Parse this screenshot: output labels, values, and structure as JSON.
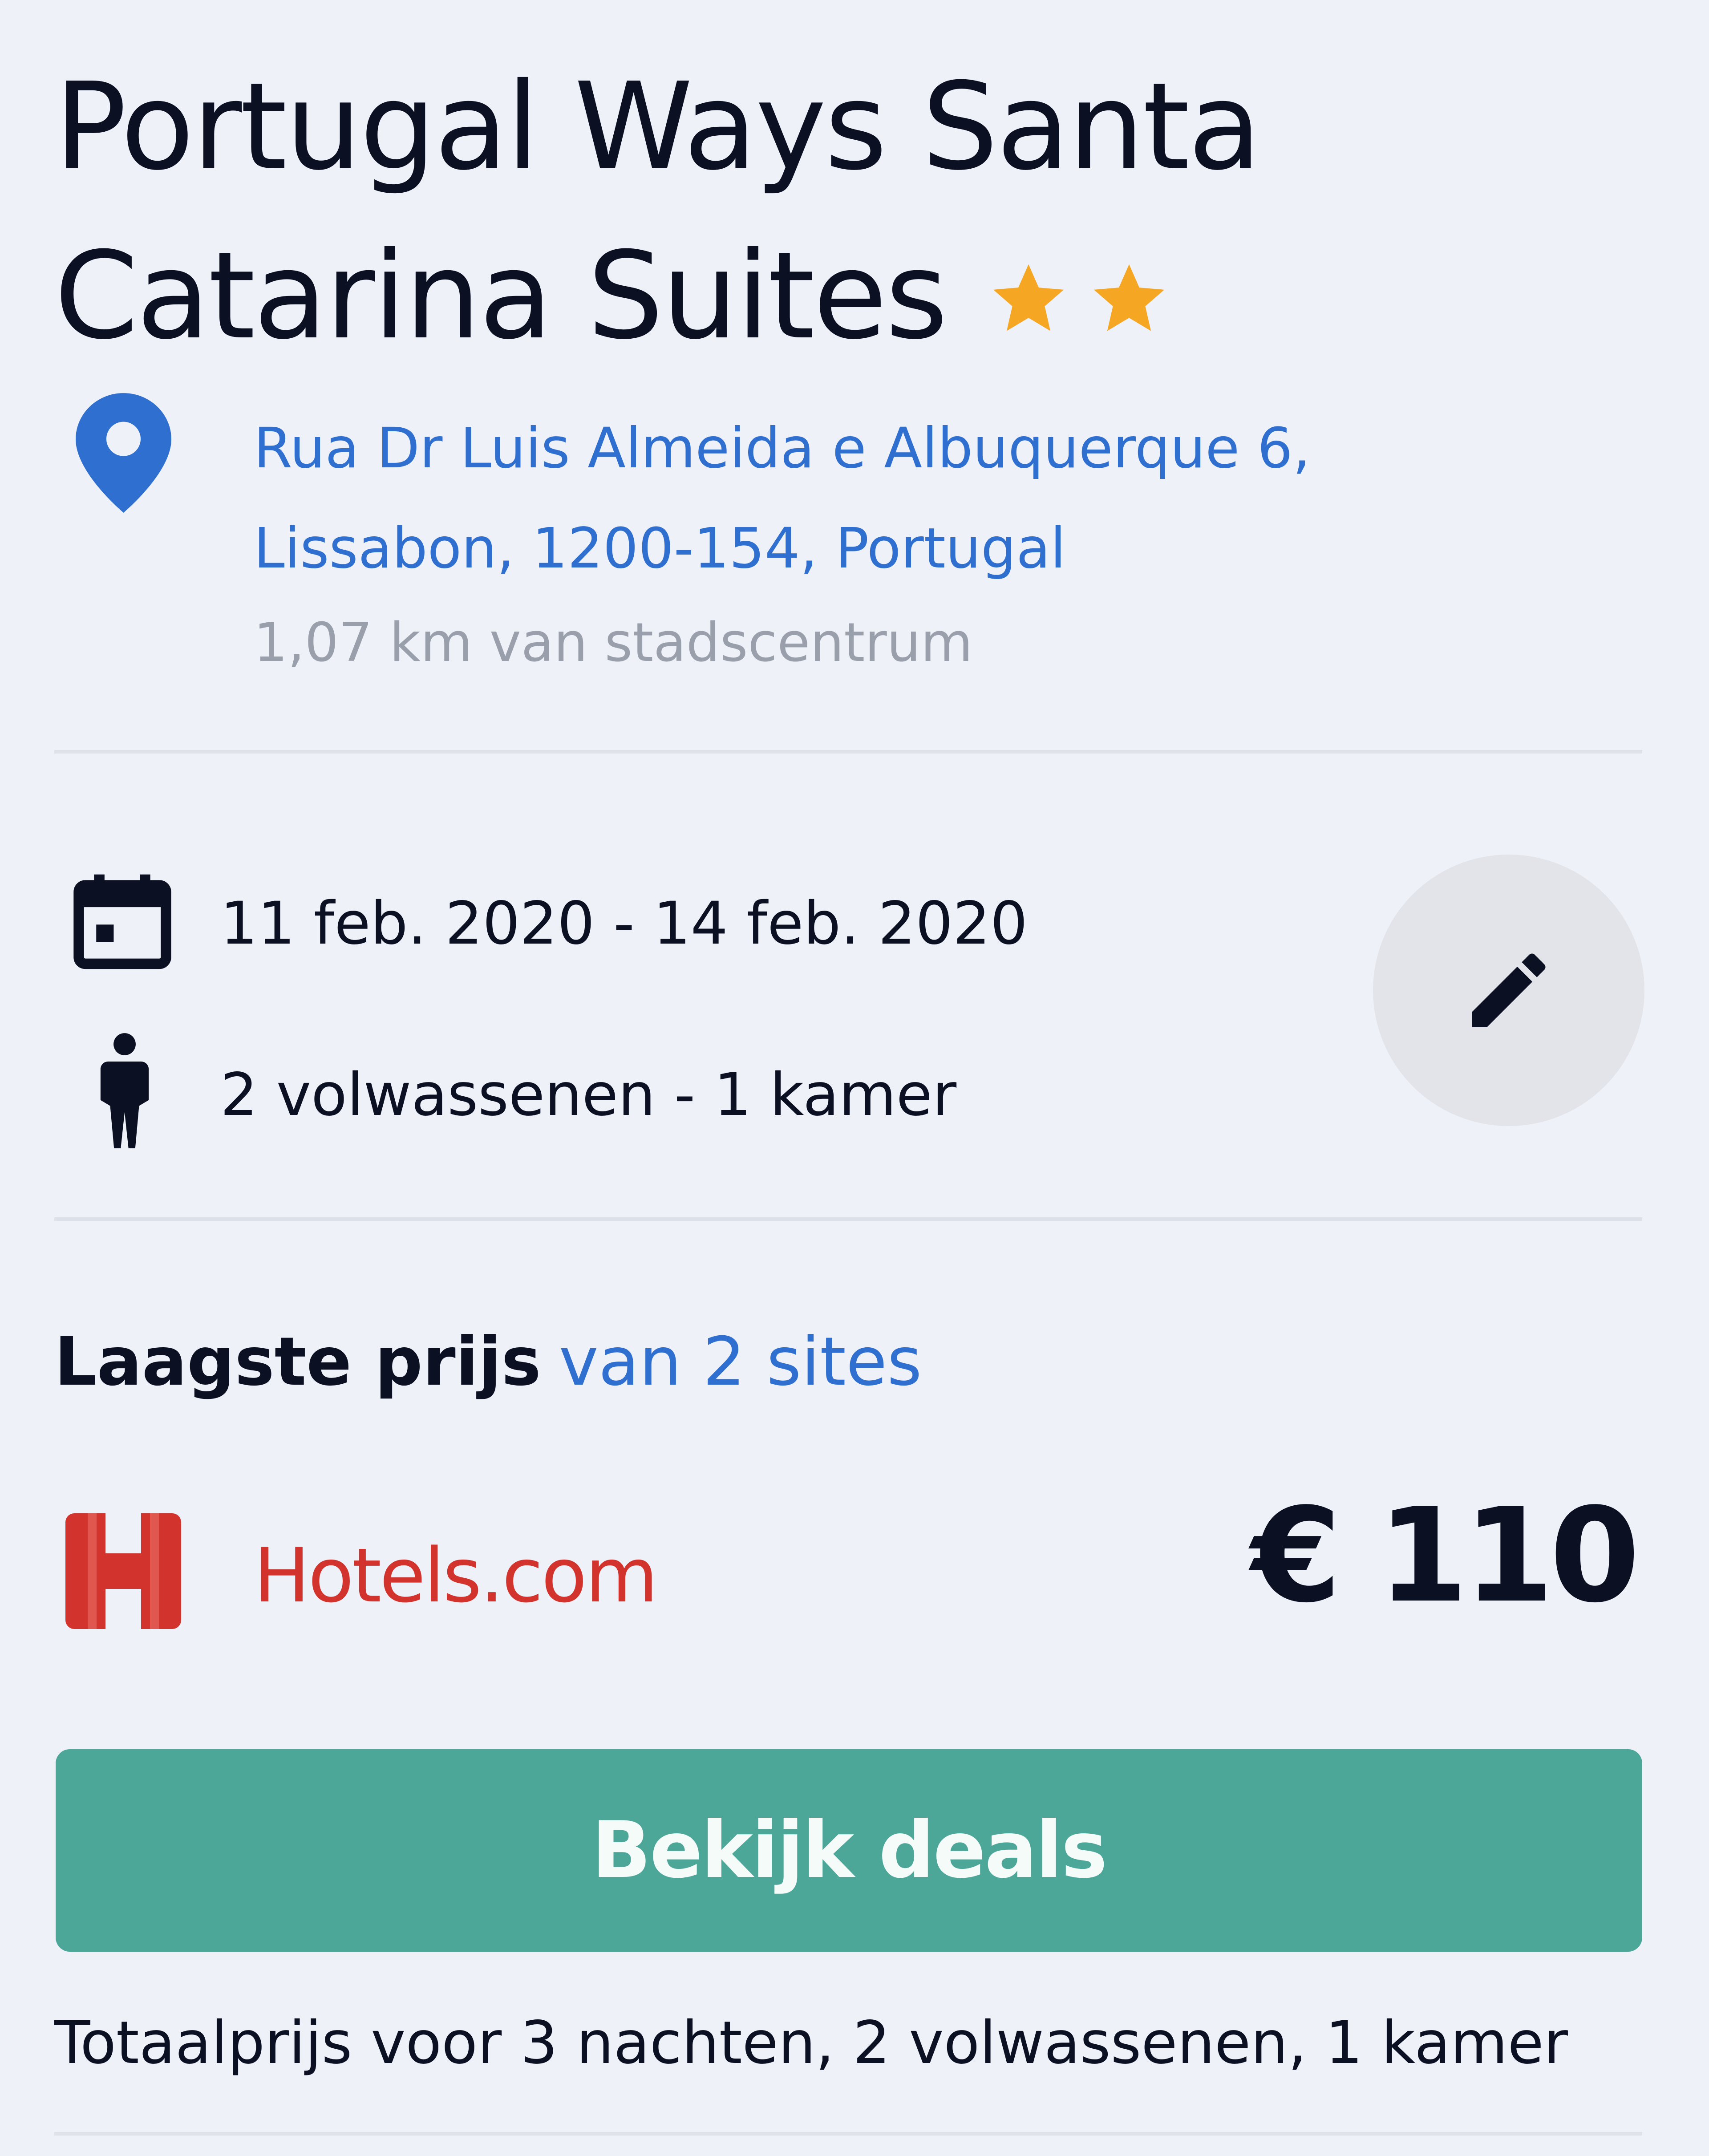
{
  "hotel": {
    "name": "Portugal Ways Santa Catarina Suites",
    "stars": 2,
    "address": "Rua Dr Luis Almeida e Albuquerque 6, Lissabon, 1200-154, Portugal",
    "distance": "1,07 km van stadscentrum"
  },
  "booking": {
    "dates": "11 feb. 2020 - 14 feb. 2020",
    "guests": "2 volwassenen - 1 kamer",
    "edit_icon": "pencil-icon"
  },
  "pricing": {
    "label_bold": "Laagste prijs",
    "sites_link": "van 2 sites",
    "provider": "Hotels.com",
    "price": "€ 110",
    "cta": "Bekijk deals",
    "total_note": "Totaalprijs voor 3 nachten, 2 volwassenen, 1 kamer"
  },
  "colors": {
    "background": "#eef1f8",
    "link": "#2f6fcf",
    "star": "#f5a623",
    "cta": "#4da799",
    "provider_red": "#d2332d"
  },
  "icons": [
    "star-icon",
    "map-pin-icon",
    "calendar-icon",
    "person-icon",
    "pencil-icon",
    "hotels-com-logo"
  ]
}
